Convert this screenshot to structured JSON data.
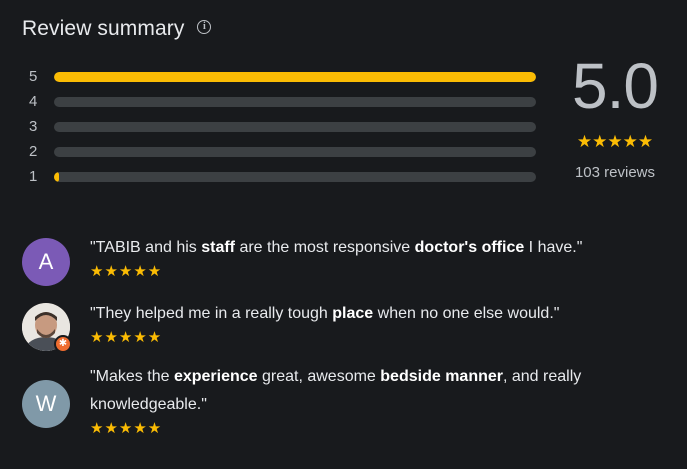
{
  "header": {
    "title": "Review summary",
    "info_icon": "info-icon"
  },
  "colors": {
    "background": "#181a1d",
    "bar_fill": "#fbbc04",
    "bar_track": "#3c4043",
    "star": "#fbbc04",
    "avatar_a": "#7b5ab6",
    "avatar_w": "#8099a8"
  },
  "distribution": [
    {
      "label": "5",
      "fraction": 1.0
    },
    {
      "label": "4",
      "fraction": 0.0
    },
    {
      "label": "3",
      "fraction": 0.0
    },
    {
      "label": "2",
      "fraction": 0.0
    },
    {
      "label": "1",
      "fraction": 0.01
    }
  ],
  "summary": {
    "rating": "5.0",
    "stars": "★★★★★",
    "count": "103 reviews"
  },
  "reviews": [
    {
      "avatar_letter": "A",
      "segments": [
        {
          "t": "\"TABIB and his ",
          "b": false
        },
        {
          "t": "staff",
          "b": true
        },
        {
          "t": " are the most responsive ",
          "b": false
        },
        {
          "t": "doctor's office",
          "b": true
        },
        {
          "t": " I have.\"",
          "b": false
        }
      ],
      "stars": "★★★★★"
    },
    {
      "avatar_letter": "",
      "segments": [
        {
          "t": "\"They helped me in a really tough ",
          "b": false
        },
        {
          "t": "place",
          "b": true
        },
        {
          "t": " when no one else would.\"",
          "b": false
        }
      ],
      "stars": "★★★★★"
    },
    {
      "avatar_letter": "W",
      "segments": [
        {
          "t": "\"Makes the ",
          "b": false
        },
        {
          "t": "experience",
          "b": true
        },
        {
          "t": " great, awesome ",
          "b": false
        },
        {
          "t": "bedside manner",
          "b": true
        },
        {
          "t": ", and really knowledgeable.\"",
          "b": false
        }
      ],
      "stars": "★★★★★"
    }
  ]
}
